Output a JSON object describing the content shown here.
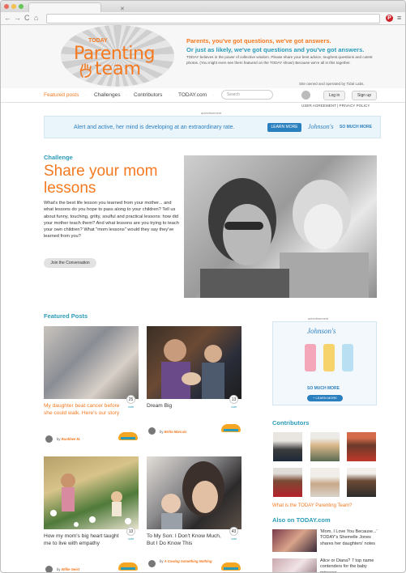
{
  "browser": {
    "pinterest_icon_text": "P"
  },
  "header": {
    "logo_today": "TODAY",
    "logo_parenting": "Parenting",
    "logo_team": "team",
    "tagline_1": "Parents, you've got questions, we've got answers.",
    "tagline_2": "Or just as likely, we've got questions and you've got answers.",
    "description": "TODAY believes in the power of collective wisdom. Please share your best advice, toughest questions and cutest photos. (You might even see them featured on the TODAY show!) Because we're all in this together.",
    "owned_by": "Site owned and operated by Tidal Labs."
  },
  "nav": {
    "items": [
      "Featured posts",
      "Challenges",
      "Contributors",
      "TODAY.com"
    ],
    "search_placeholder": "Search",
    "login_label": "Log in",
    "signup_label": "Sign up",
    "policy": "USER AGREEMENT | PRIVACY POLICY"
  },
  "top_ad": {
    "label": "advertisement",
    "text": "Alert and active, her mind is developing at an extraordinary rate.",
    "cta": "LEARN MORE",
    "brand": "Johnson's",
    "slogan": "SO MUCH MORE"
  },
  "challenge": {
    "label": "Challenge",
    "title": "Share your mom lessons",
    "description": "What's the best life lesson you learned from your mother... and what lessons do you hope to pass along to your children? Tell us about funny, touching, gritty, soulful and practical lessons: how did your mother teach them? And what lessons are you trying to teach your own children? What \"mom lessons\" would they say they've learned from you?",
    "button": "Join the Conversation"
  },
  "featured": {
    "title": "Featured Posts",
    "vote_label": "vote",
    "by": "by",
    "cards": [
      {
        "title": "My daughter beat cancer before she could walk. Here's our story",
        "votes": "25",
        "author": "Ruokhee M.",
        "highlight": true
      },
      {
        "title": "Dream Big",
        "votes": "13",
        "author": "Britta Marcais",
        "highlight": false
      },
      {
        "title": "How my mom's big heart taught me to live with empathy",
        "votes": "13",
        "author": "Willie Geist",
        "highlight": false
      },
      {
        "title": "To My Son: I Don't Know Much, But I Do Know This",
        "votes": "43",
        "author": "A Cowing Something Nothing",
        "highlight": false
      }
    ]
  },
  "side_ad": {
    "label": "advertisement",
    "brand": "Johnson's",
    "slogan": "SO MUCH MORE",
    "cta": "+ LEARN MORE"
  },
  "contributors": {
    "title": "Contributors",
    "link": "What is the TODAY Parenting Team?"
  },
  "also": {
    "title": "Also on TODAY.com",
    "items": [
      "'Mom, I Love You Because...' TODAY's Shemelle Jones shares her daughters' notes",
      "Alice or Diana? 7 top name contenders for the baby princess"
    ]
  }
}
